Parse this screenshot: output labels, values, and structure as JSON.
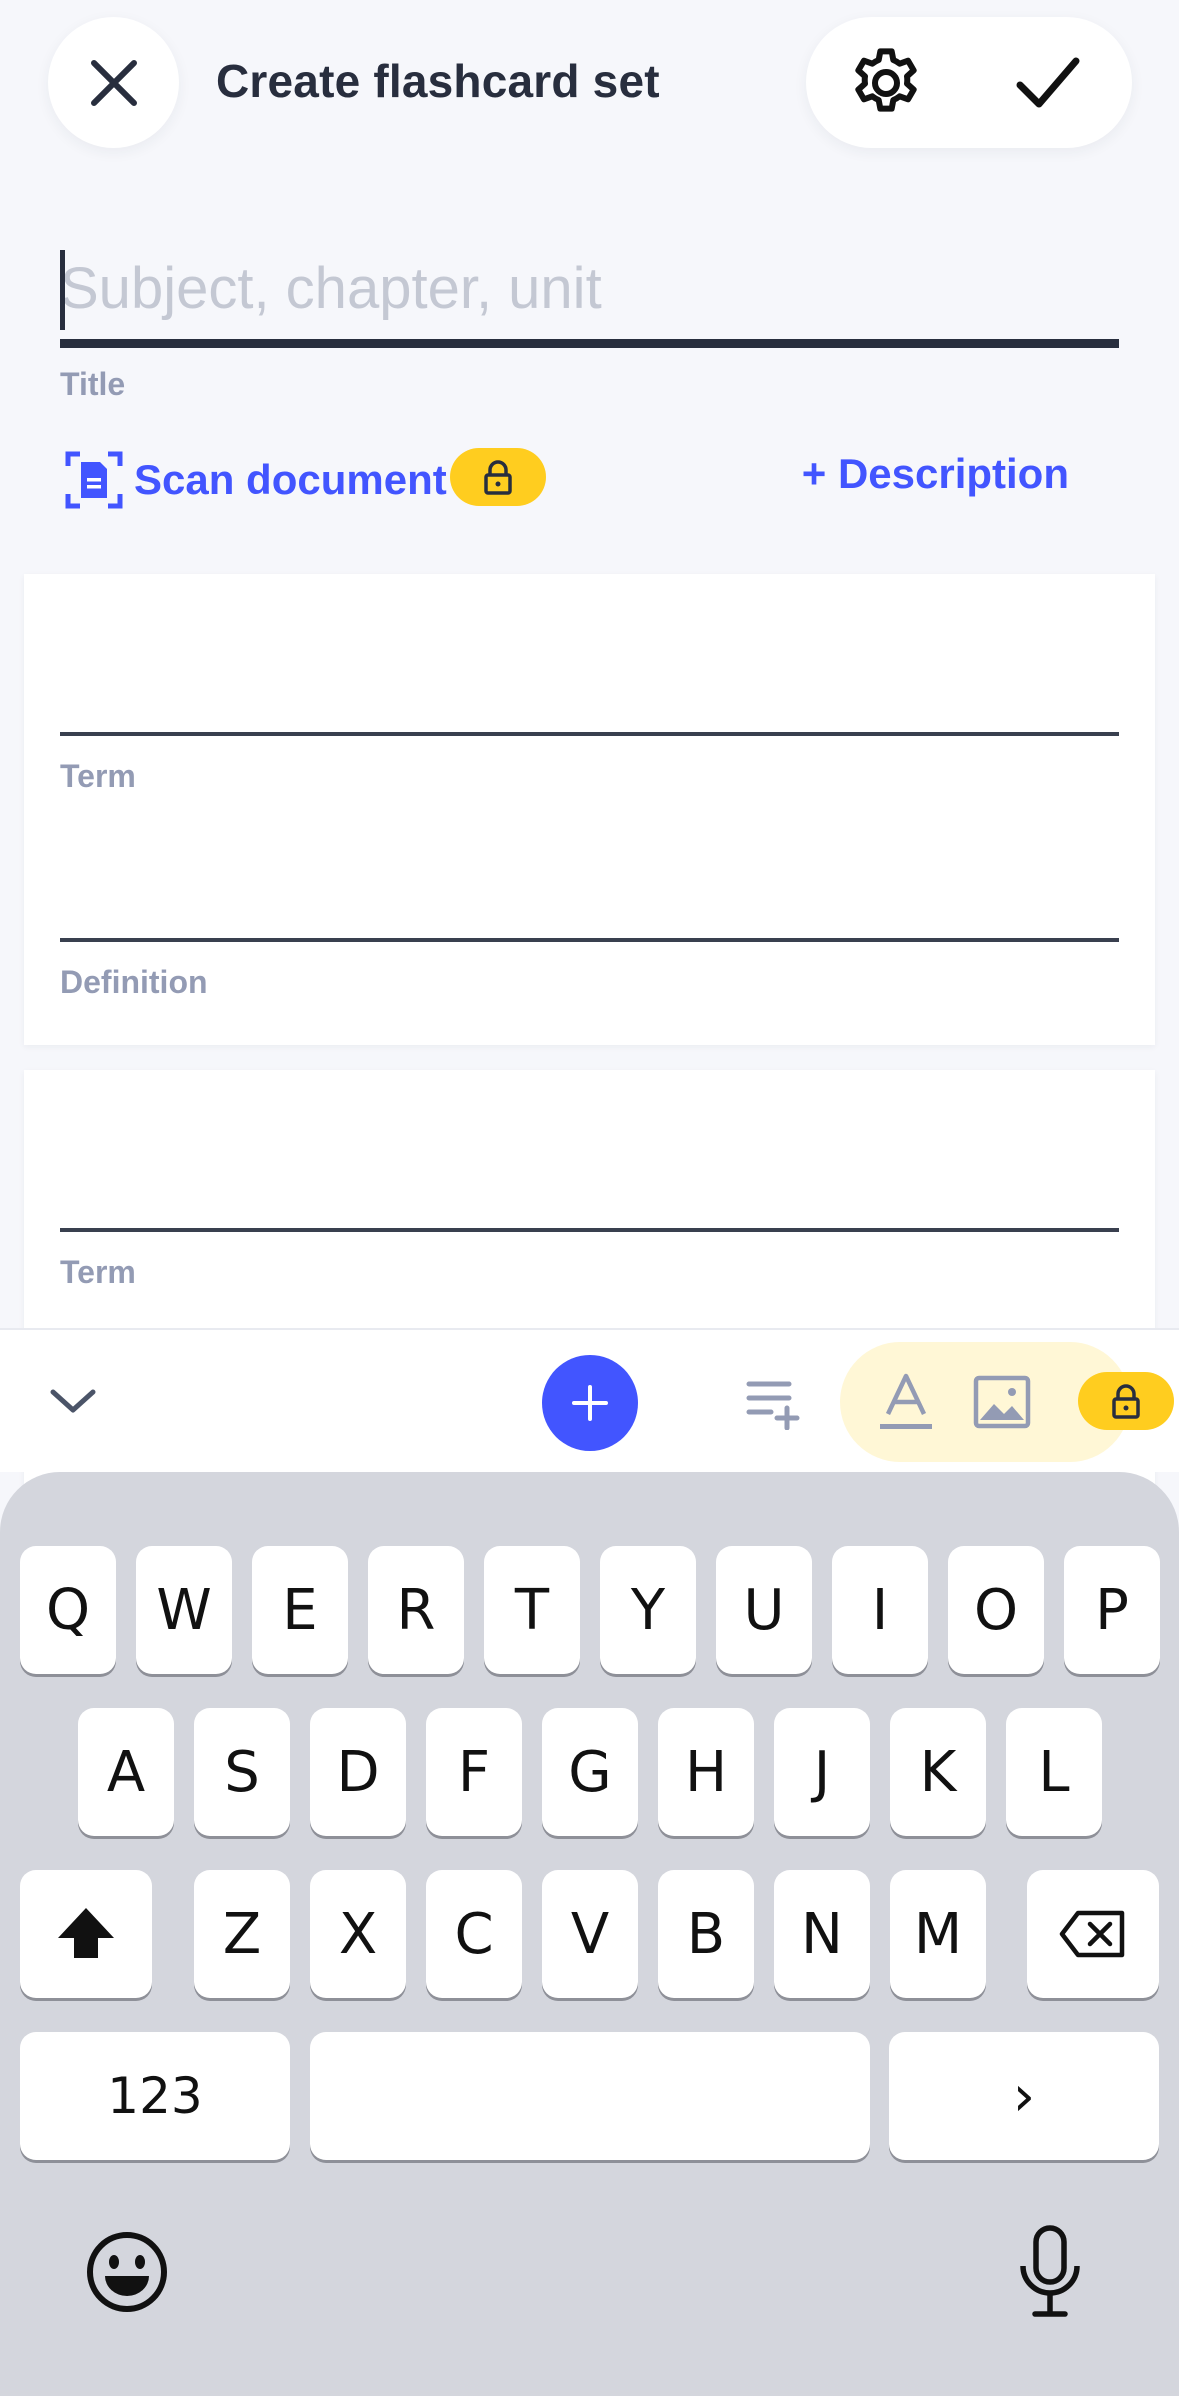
{
  "header": {
    "title": "Create flashcard set",
    "close_icon": "close-icon",
    "settings_icon": "gear-icon",
    "confirm_icon": "check-icon"
  },
  "title_field": {
    "placeholder": "Subject, chapter, unit",
    "value": "",
    "label": "Title"
  },
  "actions": {
    "scan_label": "Scan document",
    "scan_icon": "scan-document-icon",
    "scan_locked": true,
    "description_label": "+ Description"
  },
  "cards": [
    {
      "term_label": "Term",
      "definition_label": "Definition"
    },
    {
      "term_label": "Term"
    }
  ],
  "toolbar": {
    "collapse_icon": "chevron-down-icon",
    "add_icon": "plus-icon",
    "add_list_icon": "list-add-icon",
    "text_format_icon": "text-format-icon",
    "image_icon": "image-icon",
    "lock_icon": "lock-icon"
  },
  "keyboard": {
    "row1": [
      "Q",
      "W",
      "E",
      "R",
      "T",
      "Y",
      "U",
      "I",
      "O",
      "P"
    ],
    "row2": [
      "A",
      "S",
      "D",
      "F",
      "G",
      "H",
      "J",
      "K",
      "L"
    ],
    "row3": [
      "Z",
      "X",
      "C",
      "V",
      "B",
      "N",
      "M"
    ],
    "numbers_label": "123",
    "return_label": "›",
    "emoji_icon": "emoji-icon",
    "mic_icon": "microphone-icon"
  },
  "colors": {
    "accent": "#4255ff",
    "premium": "#ffcd1f",
    "text_dark": "#282e3e",
    "text_muted": "#939bb4"
  }
}
